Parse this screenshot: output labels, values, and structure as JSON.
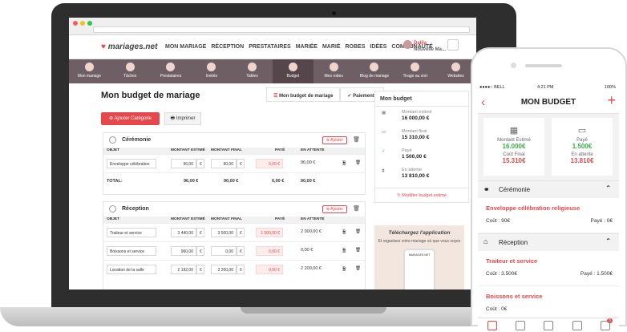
{
  "nav": {
    "logo": "mariages.net",
    "links": [
      "MON MARIAGE",
      "RÉCEPTION",
      "PRESTATAIRES",
      "MARIÉE",
      "MARIÉ",
      "ROBES",
      "IDÉES",
      "COMMUNAUTÉ"
    ],
    "user_name": "Dalila",
    "user_sub": "Nouvelle Ma..."
  },
  "toolbar": [
    "Mon mariage",
    "Tâches",
    "Prestataires",
    "Invités",
    "Tables",
    "Budget",
    "Mes robes",
    "Blog de mariage",
    "Tirage au sort",
    "Websites"
  ],
  "page": {
    "title": "Mon budget de mariage",
    "tab_budget": "Mon budget de mariage",
    "tab_payments": "Paiements",
    "add_category": "Ajouter Catégorie",
    "print": "Imprimer"
  },
  "columns": [
    "OBJET",
    "MONTANT ESTIMÉ",
    "MONTANT FINAL",
    "PAYÉ",
    "EN ATTENTE"
  ],
  "add_label": "Ajouter",
  "categories": [
    {
      "name": "Cérémonie",
      "rows": [
        {
          "obj": "Enveloppe célébration",
          "est": "96,00",
          "fin": "90,00",
          "paid": "0,00 €",
          "wait": "90,00 €"
        }
      ],
      "total": {
        "label": "TOTAL:",
        "est": "96,00 €",
        "fin": "90,00 €",
        "paid": "0,00 €",
        "wait": "90,00 €"
      }
    },
    {
      "name": "Réception",
      "rows": [
        {
          "obj": "Traiteur et service",
          "est": "3 440,00",
          "fin": "3 500,00",
          "paid": "1 500,00 €",
          "wait": "2 000,00 €"
        },
        {
          "obj": "Boissons et service",
          "est": "960,00",
          "fin": "0,00",
          "paid": "0,00 €",
          "wait": "0,00 €"
        },
        {
          "obj": "Location de la salle",
          "est": "2 192,00",
          "fin": "2 200,00",
          "paid": "0,00 €",
          "wait": "2 200,00 €"
        }
      ]
    }
  ],
  "currency": "€",
  "side": {
    "title": "Mon budget",
    "items": [
      {
        "label": "Montant estimé",
        "value": "16 000,00 €"
      },
      {
        "label": "Montant final",
        "value": "15 310,00 €"
      },
      {
        "label": "Payé",
        "value": "1 500,00 €"
      },
      {
        "label": "En attente",
        "value": "13 810,00 €"
      }
    ],
    "modify": "Modifier budget estimé",
    "promo_title": "Téléchargez l'application",
    "promo_text": "Et organisez votre mariage où que vous soyez",
    "promo_phone_label": "MARIAGES.NET"
  },
  "phone": {
    "carrier": "BELL",
    "time": "4:21 PM",
    "battery": "100%",
    "title": "MON BUDGET",
    "card1": {
      "l1": "Montant Estimé",
      "v1": "16.000€",
      "l2": "Coût Final",
      "v2": "15.310€"
    },
    "card2": {
      "l1": "Payé",
      "v1": "1.500€",
      "l2": "En attente",
      "v2": "13.810€"
    },
    "sections": [
      {
        "name": "Cérémonie",
        "items": [
          {
            "n": "Enveloppe célébration religieuse",
            "c": "Coût : 90€",
            "p": "Payé : 0€"
          }
        ]
      },
      {
        "name": "Réception",
        "items": [
          {
            "n": "Traiteur et service",
            "c": "Coût : 3.500€",
            "p": "Payé : 1.500€"
          },
          {
            "n": "Boissons et service",
            "c": "Coût : 0€",
            "p": ""
          }
        ]
      }
    ],
    "badge": "3"
  },
  "colors": {
    "accent": "#e5474a",
    "green": "#3cad4a",
    "toolbar": "#6e5f64"
  }
}
